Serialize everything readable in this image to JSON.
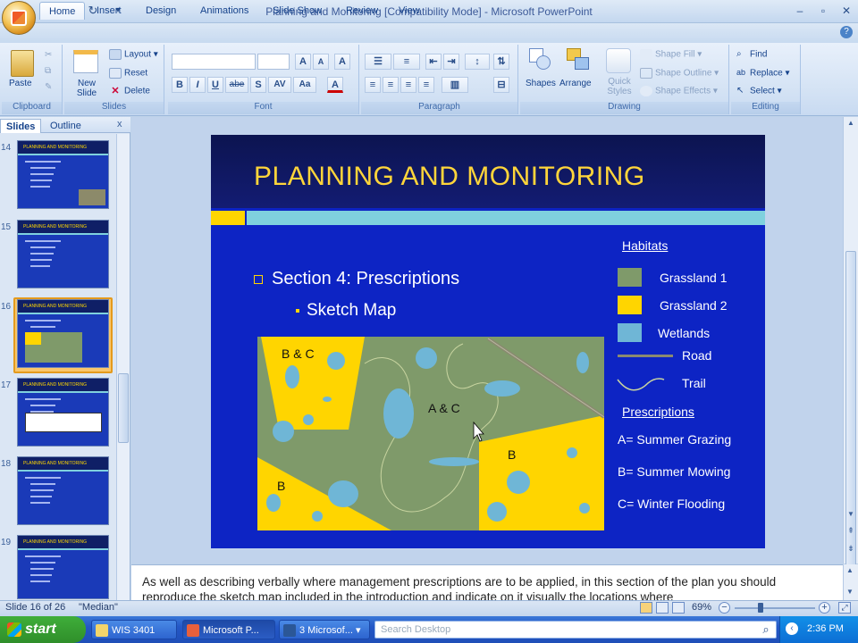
{
  "window": {
    "title": "Planning and Monitoring [Compatibility Mode] - Microsoft PowerPoint",
    "controls": [
      "–",
      "▫",
      "✕"
    ]
  },
  "quick_access": {
    "save": "save-icon",
    "undo": "undo-icon",
    "redo": "redo-icon",
    "customize": "customize-icon"
  },
  "tabs": [
    "Home",
    "Insert",
    "Design",
    "Animations",
    "Slide Show",
    "Review",
    "View"
  ],
  "active_tab": "Home",
  "ribbon": {
    "clipboard": {
      "label": "Clipboard",
      "paste": "Paste"
    },
    "slides": {
      "label": "Slides",
      "new_slide": "New Slide",
      "layout": "Layout",
      "reset": "Reset",
      "delete": "Delete"
    },
    "font": {
      "label": "Font",
      "bold": "B",
      "italic": "I",
      "underline": "U",
      "strike": "abe",
      "shadow": "S",
      "spacing": "AV",
      "case": "Aa",
      "color": "A",
      "grow": "A",
      "shrink": "A",
      "clear": "A"
    },
    "paragraph": {
      "label": "Paragraph"
    },
    "drawing": {
      "label": "Drawing",
      "shapes": "Shapes",
      "arrange": "Arrange",
      "quick_styles": "Quick Styles",
      "shape_fill": "Shape Fill",
      "shape_outline": "Shape Outline",
      "shape_effects": "Shape Effects"
    },
    "editing": {
      "label": "Editing",
      "find": "Find",
      "replace": "Replace",
      "select": "Select"
    }
  },
  "left_pane": {
    "tabs": [
      "Slides",
      "Outline"
    ],
    "active_tab": "Slides",
    "close": "x",
    "thumbnails": [
      {
        "num": "14",
        "title": "PLANNING AND MONITORING"
      },
      {
        "num": "15",
        "title": "PLANNING AND MONITORING"
      },
      {
        "num": "16",
        "title": "PLANNING AND MONITORING",
        "selected": true
      },
      {
        "num": "17",
        "title": "PLANNING AND MONITORING"
      },
      {
        "num": "18",
        "title": "PLANNING AND MONITORING"
      },
      {
        "num": "19",
        "title": "PLANNING AND MONITORING"
      }
    ]
  },
  "slide": {
    "title": "PLANNING AND MONITORING",
    "bullet1": "Section 4: Prescriptions",
    "bullet2": "Sketch Map",
    "map_labels": {
      "bc": "B & C",
      "ac": "A & C",
      "b1": "B",
      "b2": "B"
    },
    "legend": {
      "habitats": "Habitats",
      "grassland1": "Grassland 1",
      "grassland2": "Grassland 2",
      "wetlands": "Wetlands",
      "road": "Road",
      "trail": "Trail",
      "prescriptions": "Prescriptions",
      "a": "A= Summer Grazing",
      "b": "B= Summer Mowing",
      "c": "C= Winter Flooding"
    },
    "colors": {
      "grassland1": "#7f9a6a",
      "grassland2": "#ffd500",
      "wetlands": "#6fb6d6",
      "background": "#0d24c4"
    }
  },
  "notes": "As well as describing verbally where management prescriptions are to be applied, in this section of the plan you should reproduce the sketch map included in the introduction and indicate on it visually the locations where",
  "status": {
    "slide": "Slide 16 of 26",
    "theme": "\"Median\"",
    "zoom": "69%"
  },
  "taskbar": {
    "start": "start",
    "items": [
      "WIS 3401",
      "Microsoft P...",
      "3 Microsof..."
    ],
    "search_placeholder": "Search Desktop",
    "time": "2:36 PM"
  }
}
